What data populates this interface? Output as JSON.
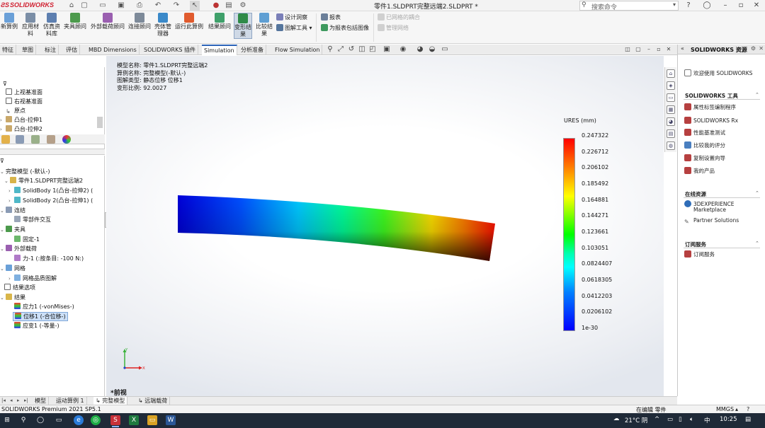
{
  "app": {
    "logo": "SOLIDWORKS",
    "document_title": "零件1.SLDPRT完整远端2.SLDPRT *",
    "search_placeholder": "搜索命令"
  },
  "ribbon": {
    "new_study_label": "新算例",
    "apply_material_label": "应用材料",
    "sim_lib_label": "仿真资料库",
    "fixtures_label": "夹具顾问",
    "loads_label": "外部载荷顾问",
    "connections_label": "连接顾问",
    "shell_mgr_label": "壳体管理器",
    "run_label": "运行此算例",
    "results_label": "结果顾问",
    "deformed_label": "变形结果",
    "compare_label": "比较结果",
    "design_insight_label": "设计洞察",
    "plot_tools_label": "图解工具",
    "report_label": "报表",
    "include_image_label": "为报表包括图像",
    "manage_network_label": "已网格的耦合",
    "manage_network2_label": "管理网络"
  },
  "command_tabs": [
    "特征",
    "草图",
    "标注",
    "评估",
    "MBD Dimensions",
    "SOLIDWORKS 插件",
    "Simulation",
    "分析准备",
    "Flow Simulation"
  ],
  "feature_tree_top": [
    {
      "label": "上视基准面"
    },
    {
      "label": "右视基准面"
    },
    {
      "label": "原点"
    },
    {
      "label": "凸台-拉伸1"
    },
    {
      "label": "凸台-拉伸2"
    }
  ],
  "study_tree": {
    "study": "完整模型 (-默认-)",
    "part": "零件1.SLDPRT完整远端2",
    "bodies": [
      "SolidBody 1(凸台-拉伸2) (",
      "SolidBody 2(凸台-拉伸1) ("
    ],
    "connections": "连结",
    "component_interaction": "零部件交互",
    "fixtures": "夹具",
    "fixed": "固定-1",
    "external_loads": "外部载荷",
    "force": "力-1 (:按条目: -100 N:)",
    "mesh": "网格",
    "mesh_quality": "网格品质图解",
    "result_options": "结果选项",
    "results": "结果",
    "stress": "应力1 (-vonMises-)",
    "displacement": "位移1 (-合位移-)",
    "strain": "应变1 (-等量-)"
  },
  "viewport": {
    "info_lines": [
      "模型名称: 零件1.SLDPRT完整远端2",
      "算例名称: 完整模型(-默认-)",
      "图解类型: 静态位移 位移1",
      "变形比例: 92.0027"
    ],
    "view_name": "*前视",
    "triad": {
      "x": "X",
      "y": "Y"
    }
  },
  "legend": {
    "title": "URES (mm)",
    "values": [
      "0.247322",
      "0.226712",
      "0.206102",
      "0.185492",
      "0.164881",
      "0.144271",
      "0.123661",
      "0.103051",
      "0.0824407",
      "0.0618305",
      "0.0412203",
      "0.0206102",
      "1e-30"
    ]
  },
  "resources": {
    "title": "SOLIDWORKS 资源",
    "welcome": "欢迎使用 SOLIDWORKS",
    "tools_section": "SOLIDWORKS 工具",
    "tools": [
      "属性标签编制程序",
      "SOLIDWORKS Rx",
      "性能基准测试",
      "比较我的评分",
      "复制设置向导",
      "我的产品"
    ],
    "online_section": "在线资源",
    "online_item_line1": "3DEXPERIENCE",
    "online_item_line2": "Marketplace",
    "partner": "Partner Solutions",
    "subscription_section": "订阅服务",
    "subscription_item": "订阅服务"
  },
  "model_tabs": [
    "模型",
    "运动算例 1",
    "完整模型",
    "远端载荷"
  ],
  "status": {
    "version": "SOLIDWORKS Premium 2021 SP5.1",
    "editing": "在编辑 零件",
    "units": "MMGS"
  },
  "taskbar": {
    "temperature": "21°C",
    "weather": "阴",
    "ime": "中",
    "time": "10:25"
  },
  "colors": {
    "accent": "#2b63b8",
    "brand": "#d01f2f",
    "taskbar": "#1f2a38"
  }
}
